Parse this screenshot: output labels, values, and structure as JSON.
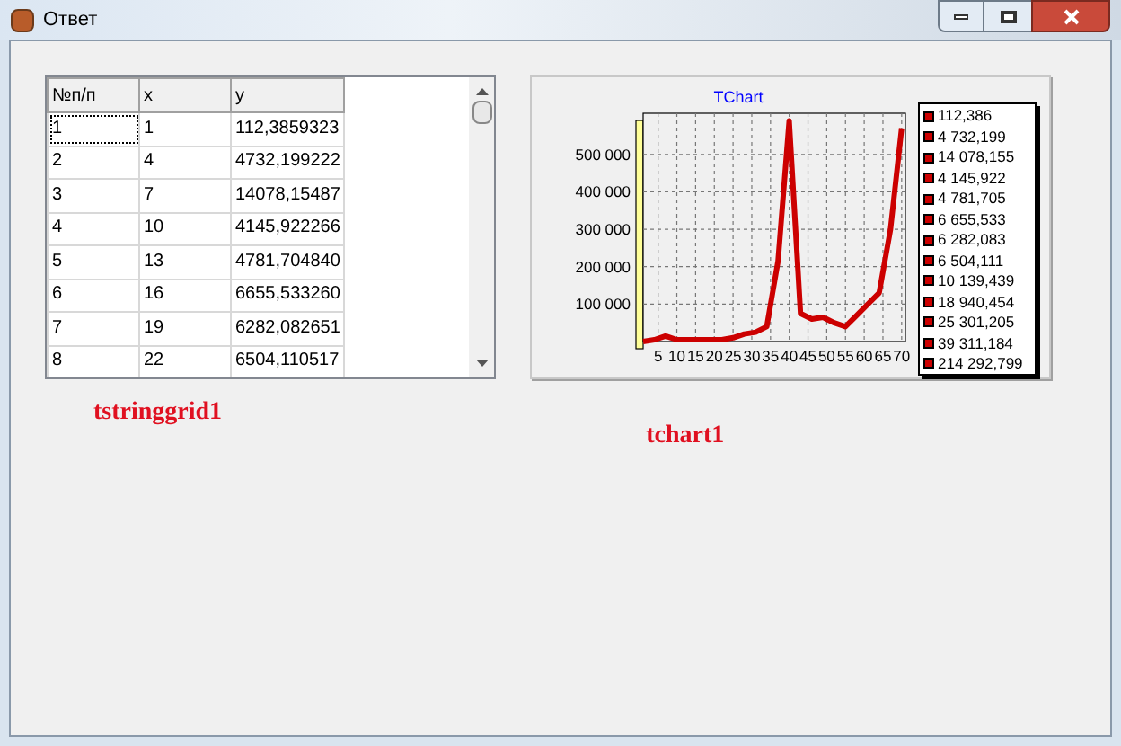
{
  "window": {
    "title": "Ответ"
  },
  "grid": {
    "columns": [
      "№п/п",
      "x",
      "y"
    ],
    "rows": [
      [
        "1",
        "1",
        "112,3859323"
      ],
      [
        "2",
        "4",
        "4732,199222"
      ],
      [
        "3",
        "7",
        "14078,15487"
      ],
      [
        "4",
        "10",
        "4145,922266"
      ],
      [
        "5",
        "13",
        "4781,704840"
      ],
      [
        "6",
        "16",
        "6655,533260"
      ],
      [
        "7",
        "19",
        "6282,082651"
      ],
      [
        "8",
        "22",
        "6504,110517"
      ]
    ]
  },
  "chart": {
    "legend": [
      "112,386",
      "4 732,199",
      "14 078,155",
      "4 145,922",
      "4 781,705",
      "6 655,533",
      "6 282,083",
      "6 504,111",
      "10 139,439",
      "18 940,454",
      "25 301,205",
      "39 311,184",
      "214 292,799"
    ],
    "chart_data": {
      "type": "line",
      "title": "TChart",
      "x": [
        1,
        4,
        7,
        10,
        13,
        16,
        19,
        22,
        25,
        28,
        31,
        34,
        37,
        40,
        43,
        46,
        49,
        52,
        55,
        58,
        61,
        64,
        67,
        70
      ],
      "series": [
        {
          "color": "#cc0000",
          "values": [
            0,
            5000,
            15000,
            5000,
            5000,
            5000,
            5000,
            5000,
            10000,
            20000,
            25000,
            40000,
            215000,
            590000,
            75000,
            60000,
            65000,
            50000,
            40000,
            70000,
            100000,
            130000,
            300000,
            570000
          ]
        }
      ],
      "grid": true,
      "xlim": [
        1,
        71
      ],
      "ylim": [
        0,
        610000
      ],
      "xticks": [
        5,
        10,
        15,
        20,
        25,
        30,
        35,
        40,
        45,
        50,
        55,
        60,
        65,
        70
      ],
      "yticks": [
        {
          "value": 100000,
          "label": "100 000"
        },
        {
          "value": 200000,
          "label": "200 000"
        },
        {
          "value": 300000,
          "label": "300 000"
        },
        {
          "value": 400000,
          "label": "400 000"
        },
        {
          "value": 500000,
          "label": "500 000"
        }
      ]
    }
  },
  "captions": [
    "tstringgrid1",
    "tchart1"
  ]
}
